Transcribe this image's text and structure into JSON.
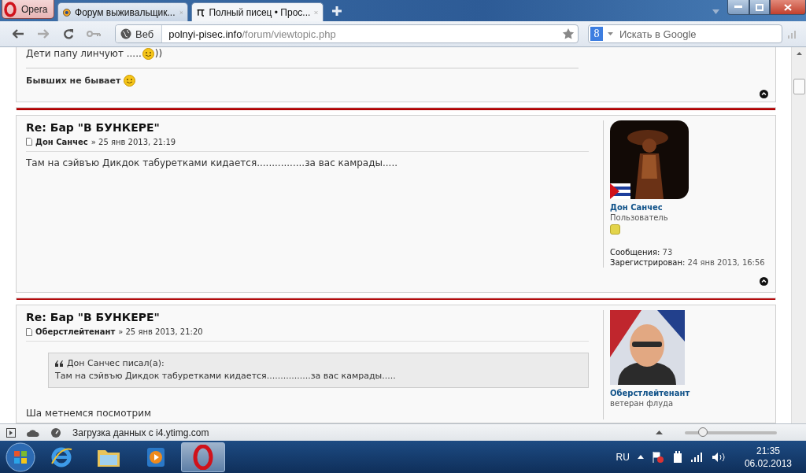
{
  "browser": {
    "menu_button": "Opera",
    "tabs": [
      {
        "title": "Форум выживальщик...",
        "selected": false
      },
      {
        "title": "Полный писец • Прос...",
        "selected": true
      }
    ],
    "address": {
      "scheme_label": "Веб",
      "host": "polnyi-pisec.info",
      "path": "/forum/viewtopic.php"
    },
    "search": {
      "engine_letter": "8",
      "placeholder": "Искать в Google"
    }
  },
  "earlier_post": {
    "body_before_smiley": "Дети папу линчуют .....",
    "body_after_smiley": "))",
    "signature": "Бывших не бывает"
  },
  "posts": [
    {
      "title": "Re: Бар \"В БУНКЕРЕ\"",
      "author": "Дон Санчес",
      "date": "» 25 янв 2013, 21:19",
      "body": "Там на сэйвъю Дикдок табуретками кидается................за вас камрады.....",
      "profile": {
        "name": "Дон Санчес",
        "rank": "Пользователь",
        "rank_badge": true,
        "posts_label": "Сообщения:",
        "posts_value": "73",
        "joined_label": "Зарегистрирован:",
        "joined_value": "24 янв 2013, 16:56"
      }
    },
    {
      "title": "Re: Бар \"В БУНКЕРЕ\"",
      "author": "Оберстлейтенант",
      "date": "» 25 янв 2013, 21:20",
      "quote": {
        "header": "Дон Санчес писал(а):",
        "text": "Там на сэйвъю Дикдок табуретками кидается................за вас камрады....."
      },
      "body": "Ша метнемся посмотрим",
      "profile": {
        "name": "Оберстлейтенант",
        "rank": "ветеран флуда"
      }
    }
  ],
  "status_bar": {
    "text": "Загрузка данных с i4.ytimg.com",
    "zoom": {
      "level": 0.2
    }
  },
  "taskbar": {
    "apps": [
      {
        "kind": "ie",
        "selected": false
      },
      {
        "kind": "folder",
        "selected": false
      },
      {
        "kind": "media",
        "selected": false
      },
      {
        "kind": "opera",
        "selected": true
      }
    ],
    "language": "RU",
    "time": "21:35",
    "date": "06.02.2013"
  }
}
